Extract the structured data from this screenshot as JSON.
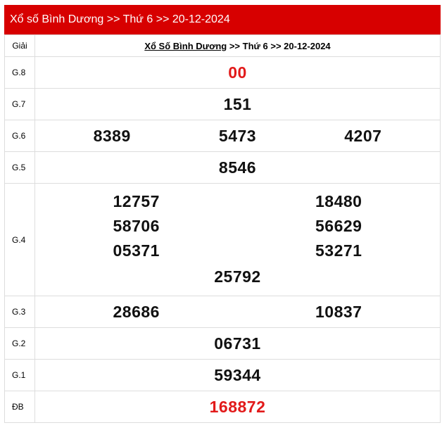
{
  "header": {
    "title": "Xổ số Bình Dương >> Thứ 6 >> 20-12-2024"
  },
  "table_head": {
    "giai_label": "Giải",
    "province_link": "Xổ Số Bình Dương",
    "suffix": ">> Thứ 6 >> 20-12-2024"
  },
  "prizes": {
    "g8": {
      "label": "G.8",
      "numbers": [
        "00"
      ]
    },
    "g7": {
      "label": "G.7",
      "numbers": [
        "151"
      ]
    },
    "g6": {
      "label": "G.6",
      "numbers": [
        "8389",
        "5473",
        "4207"
      ]
    },
    "g5": {
      "label": "G.5",
      "numbers": [
        "8546"
      ]
    },
    "g4": {
      "label": "G.4",
      "numbers": [
        "12757",
        "18480",
        "58706",
        "56629",
        "05371",
        "53271",
        "25792"
      ]
    },
    "g3": {
      "label": "G.3",
      "numbers": [
        "28686",
        "10837"
      ]
    },
    "g2": {
      "label": "G.2",
      "numbers": [
        "06731"
      ]
    },
    "g1": {
      "label": "G.1",
      "numbers": [
        "59344"
      ]
    },
    "db": {
      "label": "ĐB",
      "numbers": [
        "168872"
      ]
    }
  },
  "colors": {
    "header_bg": "#d70000",
    "highlight": "#e21a1a",
    "border": "#dddddd"
  }
}
